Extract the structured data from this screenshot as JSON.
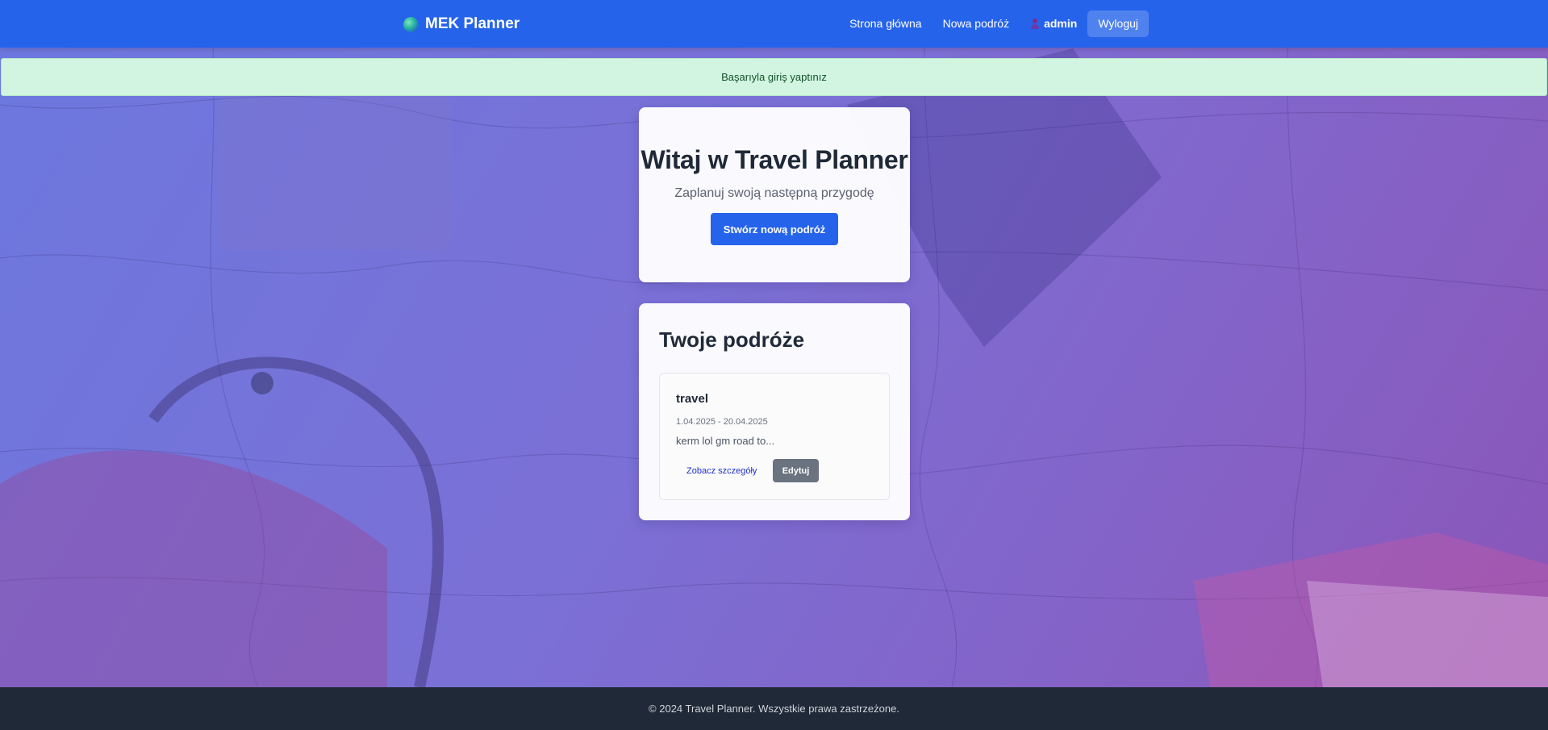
{
  "navbar": {
    "brand": "MEK Planner",
    "links": {
      "home": "Strona główna",
      "new_trip": "Nowa podróż"
    },
    "user": "admin",
    "logout": "Wyloguj"
  },
  "flash": {
    "message": "Başarıyla giriş yaptınız"
  },
  "hero": {
    "title": "Witaj w Travel Planner",
    "subtitle": "Zaplanuj swoją następną przygodę",
    "cta": "Stwórz nową podróż"
  },
  "trips": {
    "heading": "Twoje podróże",
    "items": [
      {
        "title": "travel",
        "dates": "1.04.2025 - 20.04.2025",
        "description": "kerm lol gm road to...",
        "details_label": "Zobacz szczegóły",
        "edit_label": "Edytuj"
      }
    ]
  },
  "footer": {
    "text": "© 2024 Travel Planner. Wszystkie prawa zastrzeżone."
  },
  "colors": {
    "primary": "#2563eb",
    "flash_bg": "#d1f5e0",
    "footer_bg": "#1f2937",
    "edit_btn": "#6b7280"
  }
}
